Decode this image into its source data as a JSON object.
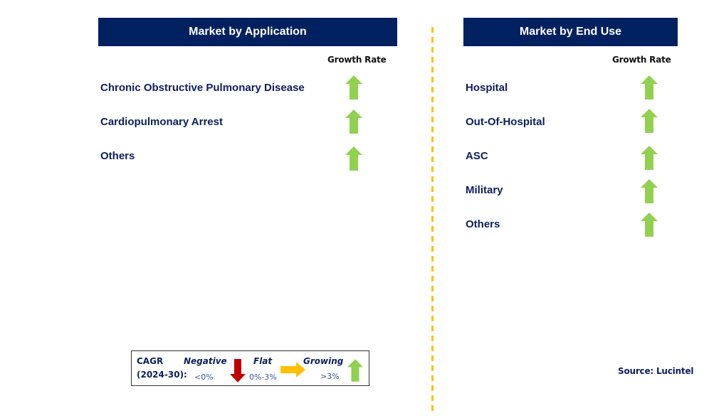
{
  "colors": {
    "header_bg": "#002060",
    "header_text": "#ffffff",
    "label_text": "#0b1f5c",
    "growing": "#92d050",
    "flat": "#ffc000",
    "negative": "#c00000",
    "divider": "#ffc000"
  },
  "left_panel": {
    "title": "Market by Application",
    "growth_header": "Growth Rate",
    "items": [
      {
        "label": "Chronic Obstructive Pulmonary Disease",
        "trend": "growing",
        "icon": "arrow-up-icon"
      },
      {
        "label": "Cardiopulmonary Arrest",
        "trend": "growing",
        "icon": "arrow-up-icon"
      },
      {
        "label": "Others",
        "trend": "growing",
        "icon": "arrow-up-icon"
      }
    ]
  },
  "right_panel": {
    "title": "Market by End Use",
    "growth_header": "Growth Rate",
    "items": [
      {
        "label": "Hospital",
        "trend": "growing",
        "icon": "arrow-up-icon"
      },
      {
        "label": "Out-Of-Hospital",
        "trend": "growing",
        "icon": "arrow-up-icon"
      },
      {
        "label": "ASC",
        "trend": "growing",
        "icon": "arrow-up-icon"
      },
      {
        "label": "Military",
        "trend": "growing",
        "icon": "arrow-up-icon"
      },
      {
        "label": "Others",
        "trend": "growing",
        "icon": "arrow-up-icon"
      }
    ]
  },
  "legend": {
    "cagr_label": "CAGR",
    "period_label": "(2024-30):",
    "categories": [
      {
        "name": "Negative",
        "range": "<0%",
        "icon": "arrow-down-icon"
      },
      {
        "name": "Flat",
        "range": "0%-3%",
        "icon": "arrow-right-icon"
      },
      {
        "name": "Growing",
        "range": ">3%",
        "icon": "arrow-up-icon"
      }
    ]
  },
  "source": "Source: Lucintel"
}
